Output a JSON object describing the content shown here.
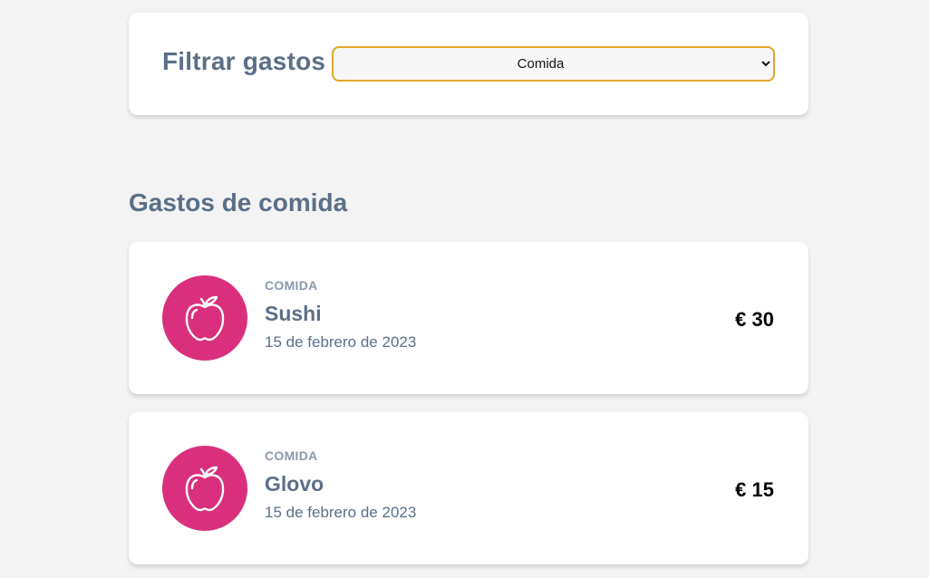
{
  "filter": {
    "label": "Filtrar gastos",
    "selected": "Comida"
  },
  "section": {
    "title": "Gastos de comida"
  },
  "expenses": [
    {
      "category": "COMIDA",
      "name": "Sushi",
      "date": "15 de febrero de 2023",
      "amount": "€ 30",
      "icon": "apple-icon"
    },
    {
      "category": "COMIDA",
      "name": "Glovo",
      "date": "15 de febrero de 2023",
      "amount": "€ 15",
      "icon": "apple-icon"
    }
  ],
  "colors": {
    "accent_border": "#e3a62a",
    "category_circle": "#da2f7c",
    "heading": "#5b6f87"
  }
}
